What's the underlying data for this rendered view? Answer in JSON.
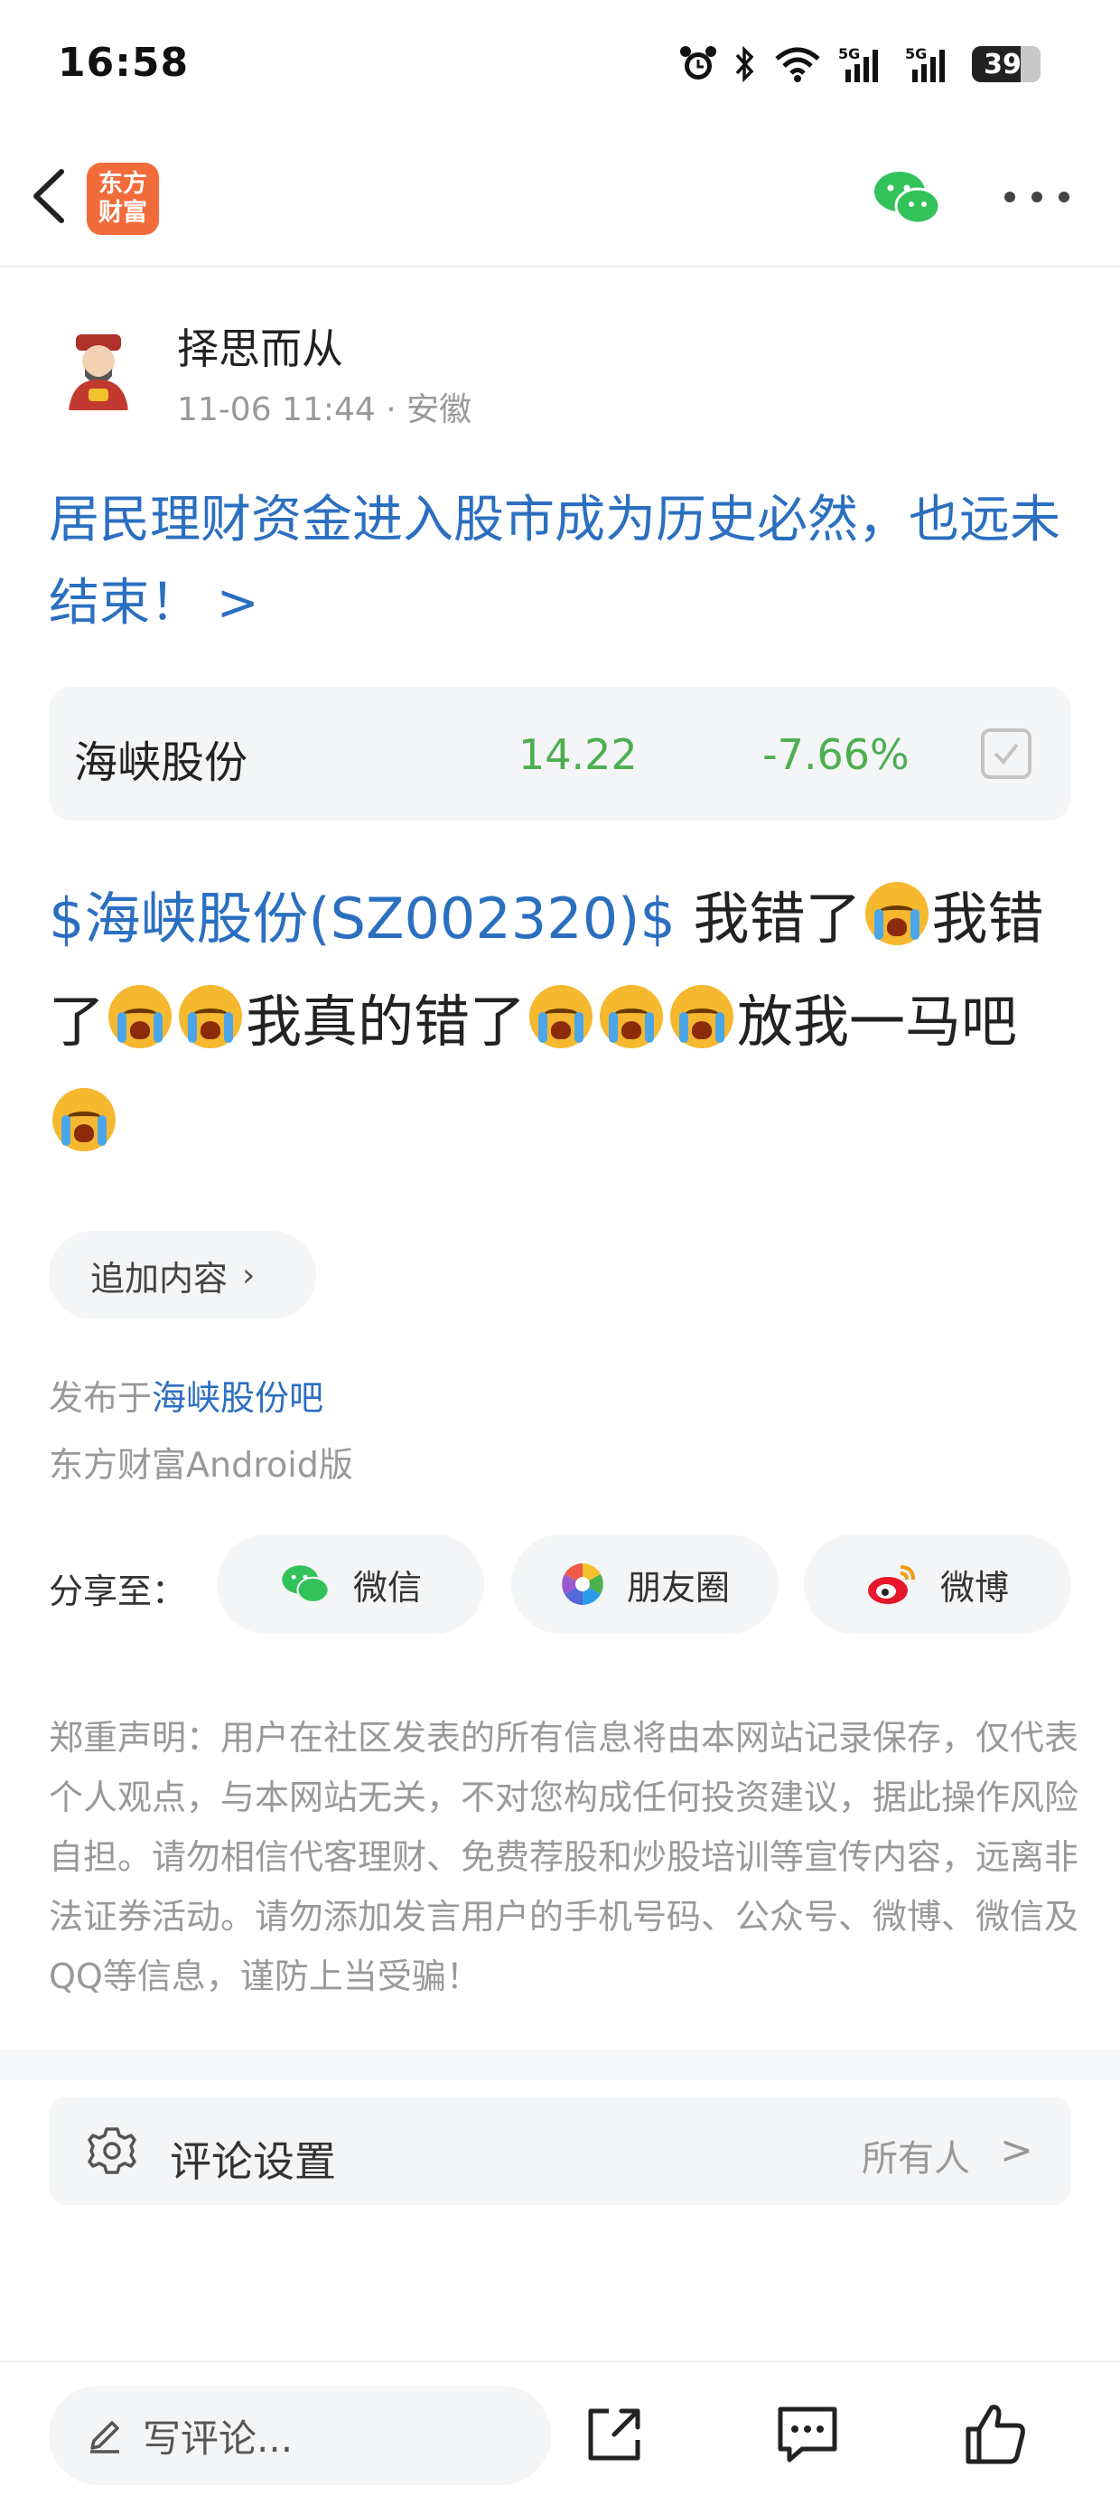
{
  "status_bar": {
    "time": "16:58",
    "battery": "39",
    "icons": [
      "alarm-icon",
      "bluetooth-icon",
      "wifi-icon",
      "5g-signal-icon",
      "5g-signal-icon"
    ]
  },
  "nav": {
    "logo_line1": "东方",
    "logo_line2": "财富",
    "icons": [
      "back-icon",
      "wechat-icon",
      "more-icon"
    ]
  },
  "author": {
    "name": "择思而从",
    "time": "11-06 11:44",
    "location": "· 安徽"
  },
  "post": {
    "title": "居民理财资金进入股市成为历史必然，也远未结束！ >",
    "stock_tag": "$海峡股份(SZ002320)$",
    "text_1": " 我错了",
    "text_2": "我错了",
    "text_3": "我真的错了",
    "text_4": "放我一马吧"
  },
  "stock_card": {
    "name": "海峡股份",
    "price": "14.22",
    "change": "-7.66%"
  },
  "append": {
    "label": "追加内容",
    "chevron": "›"
  },
  "publish": {
    "prefix": "发布于",
    "bar_name": "海峡股份吧",
    "client": "东方财富Android版"
  },
  "share": {
    "label": "分享至：",
    "wechat": "微信",
    "moments": "朋友圈",
    "weibo": "微博"
  },
  "disclaimer": "郑重声明：用户在社区发表的所有信息将由本网站记录保存，仅代表个人观点，与本网站无关，不对您构成任何投资建议，据此操作风险自担。请勿相信代客理财、免费荐股和炒股培训等宣传内容，远离非法证券活动。请勿添加发言用户的手机号码、公众号、微博、微信及QQ等信息，谨防上当受骗！",
  "comment_settings": {
    "label": "评论设置",
    "value": "所有人",
    "chevron": ">"
  },
  "bottom_bar": {
    "placeholder": "写评论..."
  },
  "colors": {
    "link_blue": "#2b6fc0",
    "stock_down": "#4caf50",
    "brand_orange": "#f26b3a",
    "wechat_green": "#31c25a"
  }
}
